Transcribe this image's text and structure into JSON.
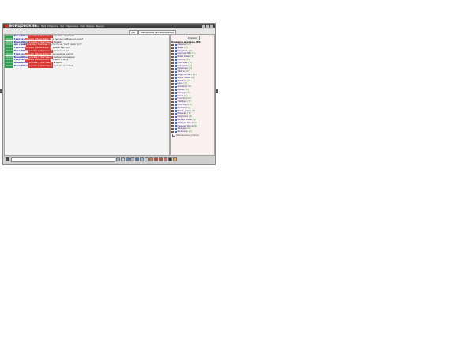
{
  "titlebar": {
    "logo": "БОЙЦОВСКИЙ",
    "nav": [
      "Мой",
      "Бой",
      "Подпись",
      "Чат",
      "Персонаж",
      "Зал",
      "Форум",
      "Выход"
    ]
  },
  "toolbar": {
    "btn1": "Чат",
    "btn2": "Обновлять автоматически"
  },
  "chat": {
    "messages": [
      {
        "time": "20:20",
        "from": "Вова Killer",
        "to": "private [ Гретхен ]",
        "text": "привет, поиграй"
      },
      {
        "time": "20:21",
        "from": "Гретхен",
        "to": "private [ Вова Killer ]",
        "text": "а ты как нибудь ко мне?"
      },
      {
        "time": "20:21",
        "from": "Вова Killer",
        "to": "private [ Гретхен ]",
        "text": "Привет"
      },
      {
        "time": "20:22",
        "from": "мы с ней",
        "to": "private [ Гретхен ]",
        "text": "что-то не так? тебе тут?"
      },
      {
        "time": "20:22",
        "from": "Гретхен",
        "to": "private [ Вова Killer ]",
        "text": "давай быстро"
      },
      {
        "time": "20:23",
        "from": "Вова Killer",
        "to": "private [ Гретхен ]",
        "text": "для меня да"
      },
      {
        "time": "20:23",
        "from": "Гретхен",
        "to": "private [ Вова Killer ]",
        "text": "начнем за чатом"
      },
      {
        "time": "20:24",
        "from": "Вова Killer",
        "to": "private [ Гретхен ]",
        "text": "сейчас проверим"
      },
      {
        "time": "20:24",
        "from": "Гретхен",
        "to": "private [ Вова Killer ]",
        "text": "ладно я жду"
      },
      {
        "time": "20:25",
        "from": "Вова Killer",
        "to": "private [ Гретхен ]",
        "text": "я здесь"
      },
      {
        "time": "20:25",
        "from": "Вова Killer",
        "to": "private [ Гретхен ]",
        "text": "сейчас за тобой"
      }
    ],
    "input_placeholder": ""
  },
  "side": {
    "button": "Список",
    "title": "Комната игроков (30)",
    "users": [
      {
        "name": "Админ",
        "level": "[10]"
      },
      {
        "name": "Дарк",
        "level": "[8]"
      },
      {
        "name": "Kingdom",
        "level": "[9]"
      },
      {
        "name": "мистер Mix",
        "level": "[7]"
      },
      {
        "name": "Вова Killer",
        "level": "[8]"
      },
      {
        "name": "Ivanov",
        "level": "[8]"
      },
      {
        "name": "Гретхен",
        "level": "[9]"
      },
      {
        "name": "marsello",
        "level": "[7]"
      },
      {
        "name": "Кувалда",
        "level": "[6]"
      },
      {
        "name": "Тайга",
        "level": "[9]"
      },
      {
        "name": "Eug Hunter",
        "level": "[10]"
      },
      {
        "name": "Black Killer",
        "level": "[8]"
      },
      {
        "name": "Wardes",
        "level": "[7]"
      },
      {
        "name": "Lexa",
        "level": "[7]"
      },
      {
        "name": "Aceskull",
        "level": "[8]"
      },
      {
        "name": "Lester",
        "level": "[8]"
      },
      {
        "name": "Danser",
        "level": "[7]"
      },
      {
        "name": "Саня",
        "level": "[9]"
      },
      {
        "name": "Hunter",
        "level": "[10]"
      },
      {
        "name": "Тайфун",
        "level": "[7]"
      },
      {
        "name": "Гретхен",
        "level": "[8]"
      },
      {
        "name": "ПАЛАЧ",
        "level": "[9]"
      },
      {
        "name": "Black_Дарк",
        "level": "[8]"
      },
      {
        "name": "Маньяк",
        "level": "[7]"
      },
      {
        "name": "Паутина",
        "level": "[9]"
      },
      {
        "name": "Белая Лань",
        "level": "[8]"
      },
      {
        "name": "Добрая Лиса",
        "level": "[7]"
      },
      {
        "name": "Пьяная Лиса",
        "level": "[8]"
      },
      {
        "name": "Звезда",
        "level": "[9]"
      },
      {
        "name": "Болонка",
        "level": "[7]"
      }
    ],
    "refresh": "Обновлять список"
  }
}
